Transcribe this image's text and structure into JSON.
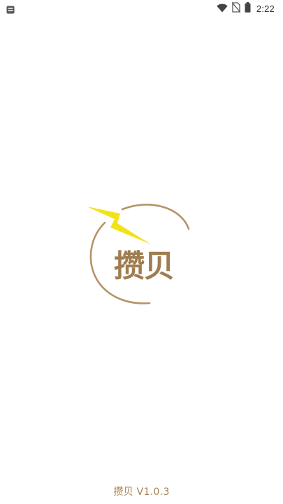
{
  "status_bar": {
    "time": "2:22",
    "icons": [
      "notification-icon",
      "wifi-icon",
      "no-sim-icon",
      "battery-icon"
    ]
  },
  "splash": {
    "logo_text": "攒贝",
    "version_text": "攒贝 V1.0.3"
  },
  "colors": {
    "brand_brown": "#9f7d50",
    "ring_tan": "#b49467",
    "bolt_yellow": "#f2e318",
    "background": "#ffffff"
  }
}
